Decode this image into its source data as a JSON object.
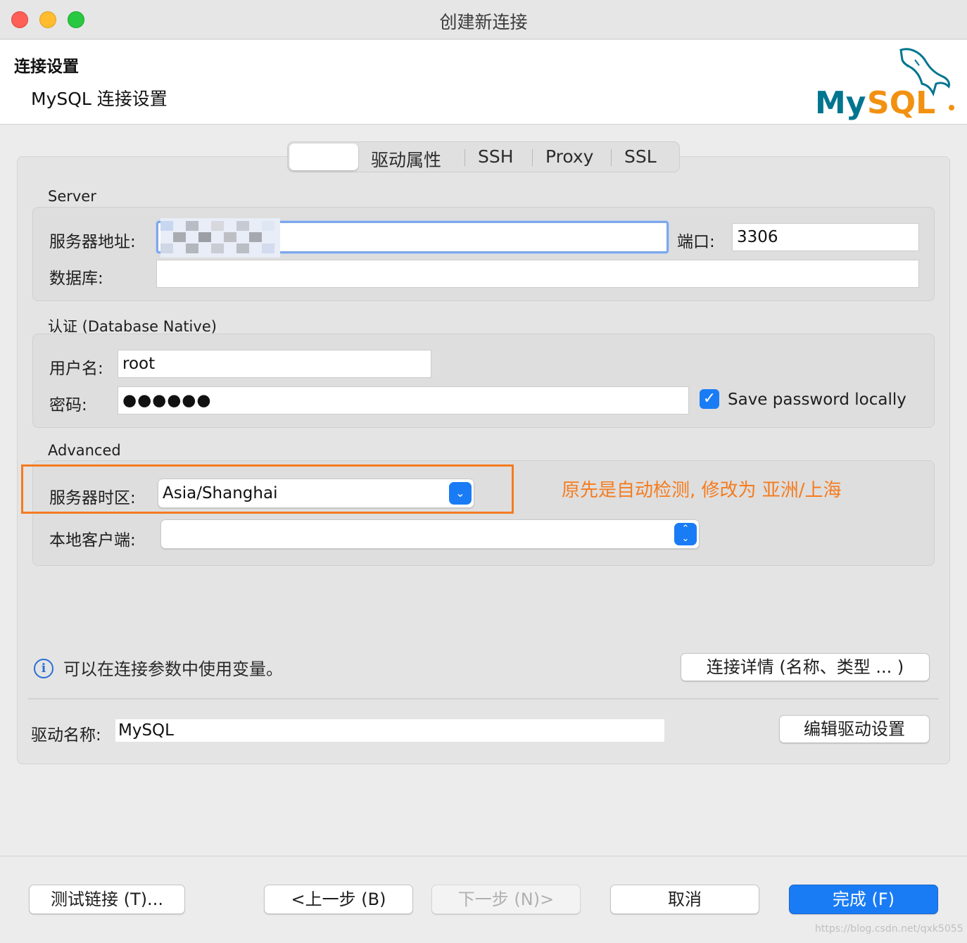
{
  "window": {
    "title": "创建新连接"
  },
  "header": {
    "title": "连接设置",
    "subtitle": "MySQL 连接设置",
    "logo_text": "MySQL"
  },
  "tabs": [
    {
      "label": "",
      "active": true
    },
    {
      "label": "驱动属性"
    },
    {
      "label": "SSH"
    },
    {
      "label": "Proxy"
    },
    {
      "label": "SSL"
    }
  ],
  "server": {
    "section": "Server",
    "host_label": "服务器地址:",
    "host_value": "",
    "port_label": "端口:",
    "port_value": "3306",
    "database_label": "数据库:",
    "database_value": ""
  },
  "auth": {
    "section": "认证 (Database Native)",
    "username_label": "用户名:",
    "username_value": "root",
    "password_label": "密码:",
    "password_value": "●●●●●●",
    "save_password_label": "Save password locally",
    "save_password_checked": true
  },
  "advanced": {
    "section": "Advanced",
    "timezone_label": "服务器时区:",
    "timezone_value": "Asia/Shanghai",
    "client_label": "本地客户端:",
    "client_value": ""
  },
  "annotation": "原先是自动检测, 修改为 亚洲/上海",
  "info_text": "可以在连接参数中使用变量。",
  "connection_details_button": "连接详情 (名称、类型 ... )",
  "driver": {
    "label": "驱动名称:",
    "value": "MySQL",
    "edit_button": "编辑驱动设置"
  },
  "footer": {
    "test_button": "测试链接 (T)...",
    "back_button": "<上一步 (B)",
    "next_button": "下一步 (N)>",
    "cancel_button": "取消",
    "finish_button": "完成 (F)"
  },
  "watermark": "https://blog.csdn.net/qxk5055",
  "colors": {
    "accent": "#1a7cf5",
    "annotation": "#f47b20",
    "mysql_blue": "#00758f",
    "mysql_orange": "#f29111"
  }
}
